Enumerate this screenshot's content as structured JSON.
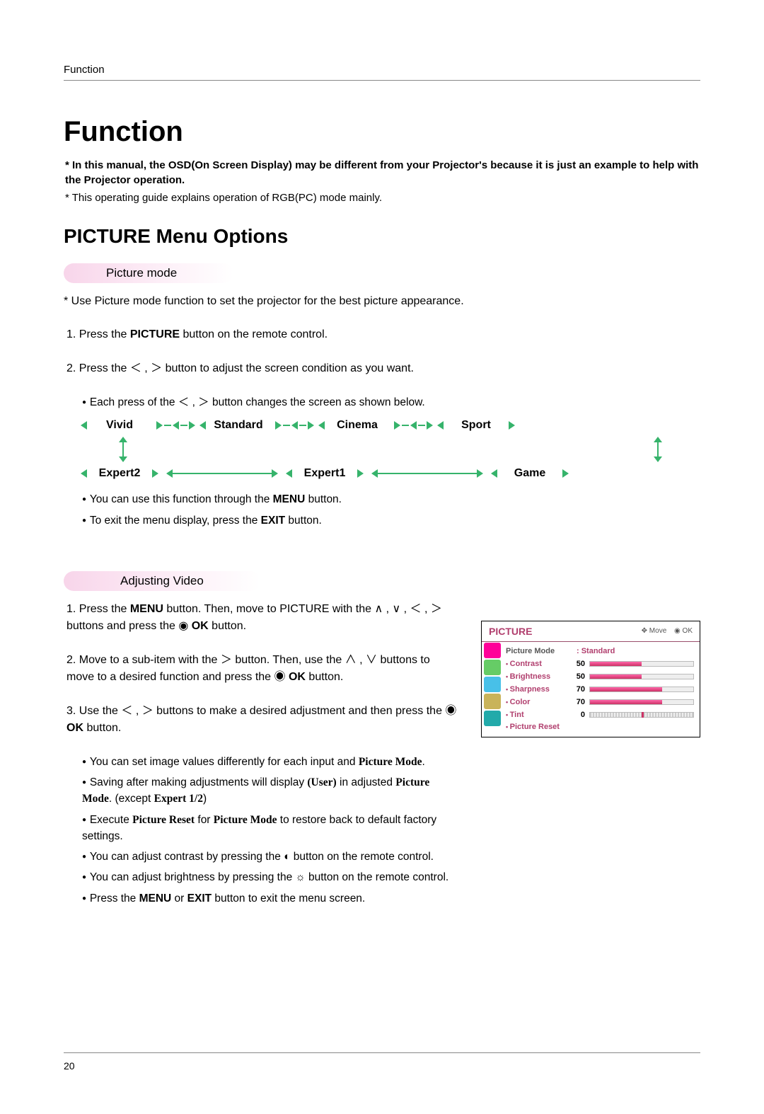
{
  "header_label": "Function",
  "h1": "Function",
  "intro_bold": "* In this manual, the OSD(On Screen Display) may be different from your Projector's because it is just an example to help with the Projector operation.",
  "intro_plain": "* This operating guide explains operation of RGB(PC) mode mainly.",
  "h2": "PICTURE Menu Options",
  "section1": {
    "pill": "Picture mode",
    "desc": "* Use Picture mode function to set the projector for the best picture appearance.",
    "step1_a": "1. Press the ",
    "step1_b": "PICTURE",
    "step1_c": " button on the remote control.",
    "step2_a": "2. Press the ",
    "step2_b": " button to adjust the screen condition as you want.",
    "bullet0_a": "Each press of the ",
    "bullet0_b": " button changes the screen as shown below.",
    "modes_top": [
      "Vivid",
      "Standard",
      "Cinema",
      "Sport"
    ],
    "modes_bottom": [
      "Expert2",
      "Expert1",
      "Game"
    ],
    "bullet1_a": "You can use this function through the ",
    "bullet1_b": "MENU",
    "bullet1_c": " button.",
    "bullet2_a": "To exit the menu display, press the ",
    "bullet2_b": "EXIT",
    "bullet2_c": " button."
  },
  "section2": {
    "pill": "Adjusting Video",
    "step1_a": "1. Press the ",
    "step1_b": "MENU",
    "step1_c": " button. Then, move to ",
    "step1_d": "PICTURE",
    "step1_e": " with the ∧ , ∨ , ＜ , ＞ buttons and press the ◉ ",
    "step1_f": "OK",
    "step1_g": " button.",
    "step2_a": "2. Move to a sub-item with the ＞ button. Then, use the ∧ , ∨ buttons to move to a desired function and press the ◉ ",
    "step2_b": "OK",
    "step2_c": " button.",
    "step3_a": "3. Use the ＜ , ＞ buttons to make a desired adjustment and then press the ◉ ",
    "step3_b": "OK",
    "step3_c": " button.",
    "b1_a": "You can set image values differently for each input and ",
    "b1_b": "Picture Mode",
    "b1_c": ".",
    "b2_a": "Saving after making adjustments will display ",
    "b2_b": "(User)",
    "b2_c": " in adjusted ",
    "b2_d": "Picture Mode",
    "b2_e": ". (except ",
    "b2_f": "Expert 1/2",
    "b2_g": ")",
    "b3_a": "Execute ",
    "b3_b": "Picture Reset",
    "b3_c": " for ",
    "b3_d": "Picture Mode",
    "b3_e": " to restore back to default factory settings.",
    "b4": "You can adjust contrast by pressing the ◐ button on the remote control.",
    "b5": "You can adjust brightness by pressing the ☼ button on the remote control.",
    "b6_a": "Press the ",
    "b6_b": "MENU",
    "b6_c": " or ",
    "b6_d": "EXIT",
    "b6_e": " button to exit the menu screen."
  },
  "osd": {
    "title": "PICTURE",
    "hint_move": "✥ Move",
    "hint_ok": "◉ OK",
    "mode_label": "Picture Mode",
    "mode_value": ": Standard",
    "items": [
      {
        "label": "Contrast",
        "value": "50",
        "pct": 50
      },
      {
        "label": "Brightness",
        "value": "50",
        "pct": 50
      },
      {
        "label": "Sharpness",
        "value": "70",
        "pct": 70
      },
      {
        "label": "Color",
        "value": "70",
        "pct": 70
      }
    ],
    "tint_label": "Tint",
    "tint_value": "0",
    "reset": "Picture Reset"
  },
  "page_no": "20"
}
